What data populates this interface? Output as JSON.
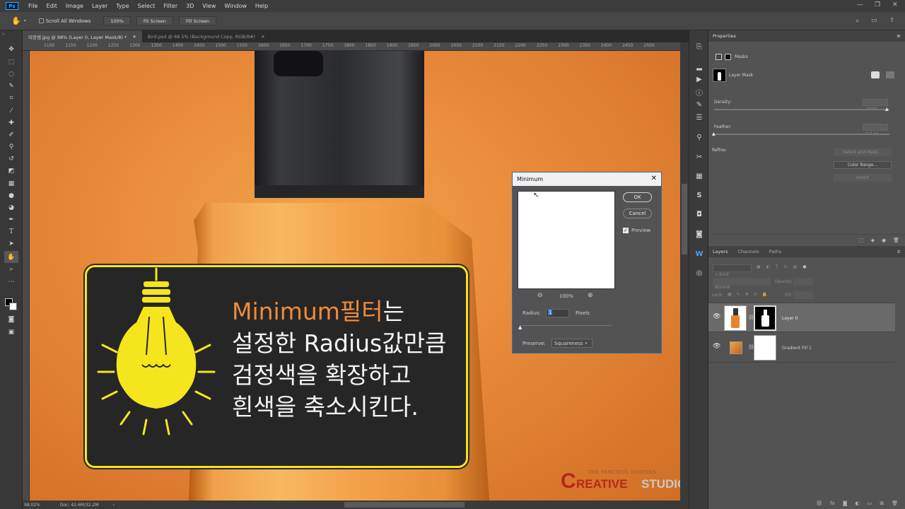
{
  "app": {
    "name": "Ps"
  },
  "menu": [
    "File",
    "Edit",
    "Image",
    "Layer",
    "Type",
    "Select",
    "Filter",
    "3D",
    "View",
    "Window",
    "Help"
  ],
  "options": {
    "scroll_all": "Scroll All Windows",
    "zoom": "100%",
    "fit_screen": "Fit Screen",
    "fill_screen": "Fill Screen"
  },
  "tabs": [
    {
      "label": "미장생.jpg @ 98% (Layer 0, Layer Mask/8) *",
      "active": true
    },
    {
      "label": "Bird.psd @ 68.5% (Background Copy, RGB/8#)",
      "active": false
    }
  ],
  "ruler_ticks": [
    "1100",
    "1150",
    "1200",
    "1250",
    "1300",
    "1350",
    "1400",
    "1450",
    "1500",
    "1550",
    "1600",
    "1650",
    "1700",
    "1750",
    "1800",
    "1850",
    "1900",
    "1950",
    "2000",
    "2050",
    "2100",
    "2150",
    "2200",
    "2250",
    "2300",
    "2350",
    "2400",
    "2450",
    "2500"
  ],
  "status": {
    "zoom": "98.02%",
    "doc": "Doc: 42.6M/32.2M"
  },
  "properties": {
    "tab": "Properties",
    "masks": "Masks",
    "layer_mask": "Layer Mask",
    "density_label": "Density:",
    "density_value": "100%",
    "feather_label": "Feather:",
    "feather_value": "0.0 px",
    "refine_label": "Refine:",
    "select_and_mask": "Select and Mask...",
    "color_range": "Color Range...",
    "invert": "Invert"
  },
  "layers_panel": {
    "tabs": [
      "Layers",
      "Channels",
      "Paths"
    ],
    "kind": "Kind",
    "blend": "Normal",
    "opacity": "Opacity:",
    "lock": "Lock:",
    "fill": "Fill:",
    "items": [
      {
        "name": "Layer 0",
        "selected": true
      },
      {
        "name": "Gradient Fill 1",
        "selected": false
      }
    ]
  },
  "dialog": {
    "title": "Minimum",
    "ok": "OK",
    "cancel": "Cancel",
    "preview": "Preview",
    "preview_checked": true,
    "zoom": "100%",
    "radius_label": "Radius:",
    "radius_value": "1",
    "radius_unit": "Pixels",
    "preserve_label": "Preserve:",
    "preserve_value": "Squareness"
  },
  "callout": {
    "line1_highlight": "Minimum필터",
    "line1_rest": "는",
    "line2": "설정한 Radius값만큼",
    "line3": "검정색을 확장하고",
    "line4": "흰색을 축소시킨다."
  },
  "watermark": {
    "top": "THE FANCIFUL DESIGNS",
    "c": "C",
    "reative": "REATIVE",
    "studio": "STUDIO"
  },
  "colors": {
    "accent": "#f5e51d",
    "orange_text": "#f08b3a",
    "brand_red": "#c0392b"
  }
}
